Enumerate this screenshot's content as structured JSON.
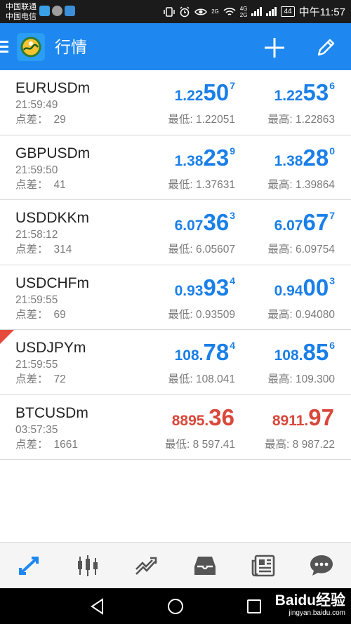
{
  "status_bar": {
    "carrier_1": "中国联通",
    "carrier_2": "中国电信",
    "network_1": "2G",
    "network_2": "4G",
    "network_2b": "2G",
    "battery": "44",
    "time": "中午11:57",
    "icons": [
      "vibrate-icon",
      "alarm-icon",
      "eye-icon",
      "wifi-icon",
      "signal-icon"
    ]
  },
  "app_bar": {
    "title": "行情",
    "logo": "metatrader-logo",
    "actions": [
      "add-icon",
      "edit-icon"
    ],
    "color": "#1e88f0"
  },
  "labels": {
    "spread": "点差：",
    "low": "最低:",
    "high": "最高:"
  },
  "colors": {
    "up": "#1a7fe8",
    "down": "#d9483b"
  },
  "quotes": [
    {
      "symbol": "EURUSDm",
      "time": "21:59:49",
      "spread": "29",
      "bid": {
        "small": "1.22",
        "big": "50",
        "sup": "7"
      },
      "ask": {
        "small": "1.22",
        "big": "53",
        "sup": "6"
      },
      "low": "1.22051",
      "high": "1.22863",
      "direction": "up"
    },
    {
      "symbol": "GBPUSDm",
      "time": "21:59:50",
      "spread": "41",
      "bid": {
        "small": "1.38",
        "big": "23",
        "sup": "9"
      },
      "ask": {
        "small": "1.38",
        "big": "28",
        "sup": "0"
      },
      "low": "1.37631",
      "high": "1.39864",
      "direction": "up"
    },
    {
      "symbol": "USDDKKm",
      "time": "21:58:12",
      "spread": "314",
      "bid": {
        "small": "6.07",
        "big": "36",
        "sup": "3"
      },
      "ask": {
        "small": "6.07",
        "big": "67",
        "sup": "7"
      },
      "low": "6.05607",
      "high": "6.09754",
      "direction": "up"
    },
    {
      "symbol": "USDCHFm",
      "time": "21:59:55",
      "spread": "69",
      "bid": {
        "small": "0.93",
        "big": "93",
        "sup": "4"
      },
      "ask": {
        "small": "0.94",
        "big": "00",
        "sup": "3"
      },
      "low": "0.93509",
      "high": "0.94080",
      "direction": "up"
    },
    {
      "symbol": "USDJPYm",
      "time": "21:59:55",
      "spread": "72",
      "bid": {
        "small": "108.",
        "big": "78",
        "sup": "4"
      },
      "ask": {
        "small": "108.",
        "big": "85",
        "sup": "6"
      },
      "low": "108.041",
      "high": "109.300",
      "direction": "up",
      "flag": true
    },
    {
      "symbol": "BTCUSDm",
      "time": "03:57:35",
      "spread": "1661",
      "bid": {
        "small": "8895.",
        "big": "36",
        "sup": ""
      },
      "ask": {
        "small": "8911.",
        "big": "97",
        "sup": ""
      },
      "low": "8 597.41",
      "high": "8 987.22",
      "direction": "down"
    }
  ],
  "bottom_nav": [
    {
      "name": "quotes",
      "icon": "quotes-arrows-icon",
      "active": true
    },
    {
      "name": "chart",
      "icon": "candlestick-icon"
    },
    {
      "name": "trade",
      "icon": "trend-icon"
    },
    {
      "name": "history",
      "icon": "inbox-icon"
    },
    {
      "name": "news",
      "icon": "news-icon"
    },
    {
      "name": "chat",
      "icon": "chat-icon"
    }
  ],
  "watermark": {
    "brand": "Bai⁠du经验",
    "url": "jingyan.baidu.com"
  }
}
